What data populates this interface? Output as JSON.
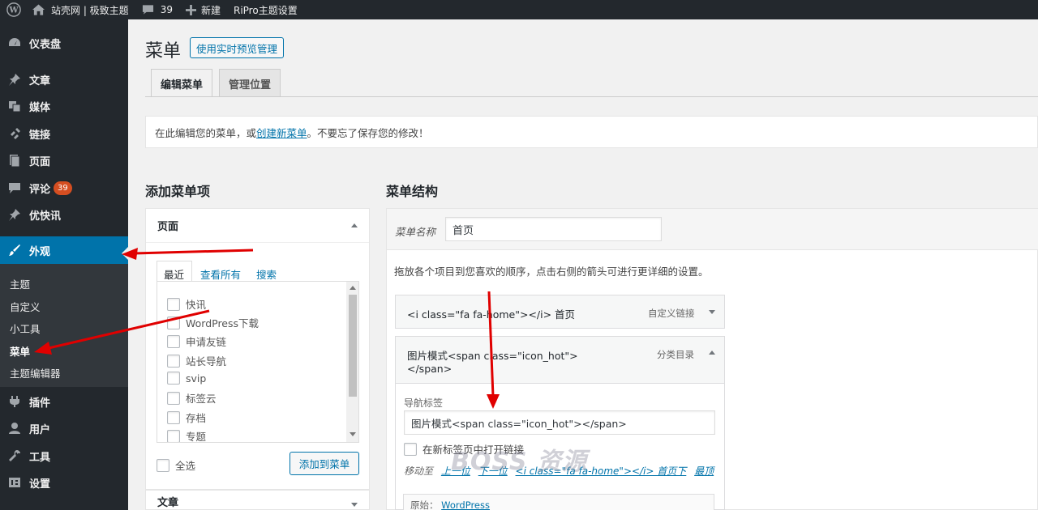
{
  "admin_bar": {
    "site_name": "站壳网 | 极致主题",
    "comments_count": "39",
    "new_label": "新建",
    "theme_settings_label": "RiPro主题设置"
  },
  "sidebar": {
    "items": [
      {
        "label": "仪表盘",
        "icon": "dashboard-icon"
      },
      {
        "label": "文章",
        "icon": "pin-icon"
      },
      {
        "label": "媒体",
        "icon": "media-icon"
      },
      {
        "label": "链接",
        "icon": "link-icon"
      },
      {
        "label": "页面",
        "icon": "page-icon"
      },
      {
        "label": "评论",
        "icon": "comment-icon",
        "badge": "39"
      },
      {
        "label": "优快讯",
        "icon": "pin-icon"
      },
      {
        "label": "外观",
        "icon": "appearance-icon",
        "current": true
      },
      {
        "label": "插件",
        "icon": "plugin-icon"
      },
      {
        "label": "用户",
        "icon": "user-icon"
      },
      {
        "label": "工具",
        "icon": "wrench-icon"
      },
      {
        "label": "设置",
        "icon": "settings-icon"
      }
    ],
    "submenu": [
      "主题",
      "自定义",
      "小工具",
      "菜单",
      "主题编辑器"
    ]
  },
  "header": {
    "title": "菜单",
    "live_preview_button": "使用实时预览管理",
    "tabs": [
      "编辑菜单",
      "管理位置"
    ]
  },
  "notice": {
    "prefix": "在此编辑您的菜单，或",
    "link": "创建新菜单",
    "suffix": "。不要忘了保存您的修改！"
  },
  "add_items": {
    "heading": "添加菜单项",
    "pages_box_title": "页面",
    "tabs": [
      "最近",
      "查看所有",
      "搜索"
    ],
    "pages": [
      "快讯",
      "WordPress下载",
      "申请友链",
      "站长导航",
      "svip",
      "标签云",
      "存档",
      "专题"
    ],
    "select_all": "全选",
    "add_button": "添加到菜单",
    "posts_box_title": "文章"
  },
  "structure": {
    "heading": "菜单结构",
    "name_label": "菜单名称",
    "name_value": "首页",
    "drag_hint": "拖放各个项目到您喜欢的顺序，点击右侧的箭头可进行更详细的设置。",
    "items": [
      {
        "title": "<i class=\"fa fa-home\"></i> 首页",
        "type": "自定义链接"
      },
      {
        "title_line1": "图片模式<span class=\"icon_hot\">",
        "title_line2": "</span>",
        "type": "分类目录"
      }
    ],
    "nav_label_caption": "导航标签",
    "nav_label_value": "图片模式<span class=\"icon_hot\"></span>",
    "new_tab_label": "在新标签页中打开链接",
    "move_to_label": "移动至",
    "move_links": [
      "上一位",
      "下一位",
      "<i class=\"fa fa-home\"></i> 首页下",
      "最顶"
    ],
    "original_label": "原始：",
    "original_link": "WordPress"
  },
  "watermark": "BOSS 资源",
  "colors": {
    "accent": "#0073aa",
    "sidebar_bg": "#23282d",
    "annotation_arrow": "#e00000",
    "badge": "#d54e21"
  }
}
